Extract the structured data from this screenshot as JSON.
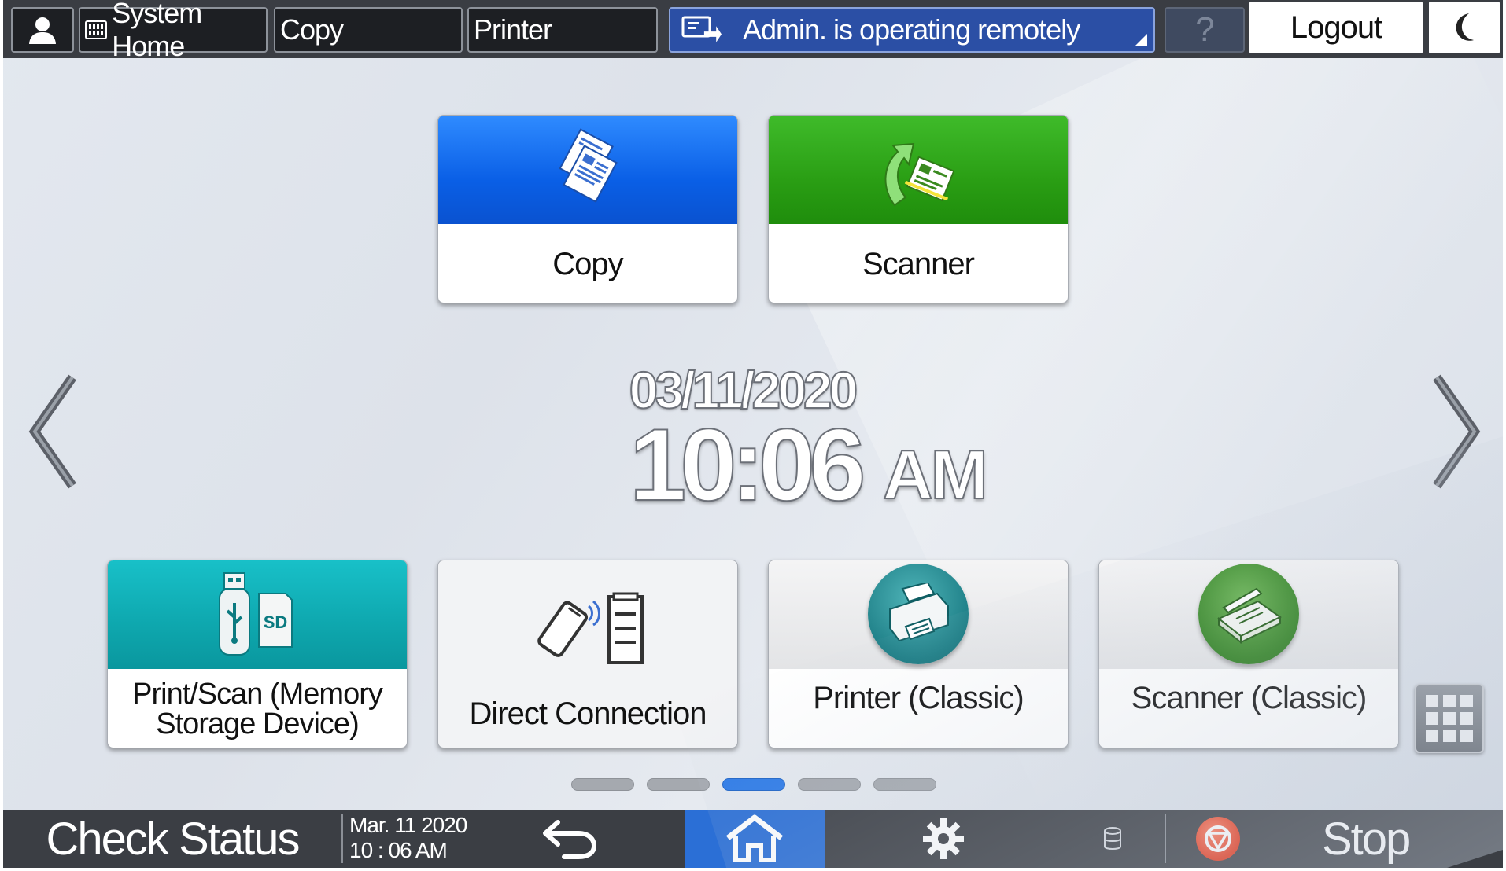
{
  "top_bar": {
    "system_home_label": "System Home",
    "copy_tab_label": "Copy",
    "printer_tab_label": "Printer",
    "remote_message": "Admin. is operating remotely",
    "help_label": "?",
    "logout_label": "Logout"
  },
  "tiles": {
    "copy": "Copy",
    "scanner": "Scanner",
    "memory_line1": "Print/Scan (Memory",
    "memory_line2": "Storage Device)",
    "memory_sd_label": "SD",
    "direct_connection": "Direct Connection",
    "printer_classic": "Printer (Classic)",
    "scanner_classic": "Scanner (Classic)"
  },
  "clock": {
    "date": "03/11/2020",
    "time": "10:06",
    "ampm": "AM"
  },
  "page_indicator": {
    "total": 5,
    "active_index": 2
  },
  "bottom_bar": {
    "check_status_label": "Check Status",
    "date_line": "Mar. 11 2020",
    "time_line": "10 : 06 AM",
    "stop_label": "Stop"
  },
  "colors": {
    "copy_tile": "#0a5fe6",
    "scanner_tile": "#2a9e14",
    "memory_tile": "#0ea7ae",
    "home_active": "#2b6fd6",
    "remote_bar": "#2b4fa5",
    "stop": "#e8381a"
  }
}
